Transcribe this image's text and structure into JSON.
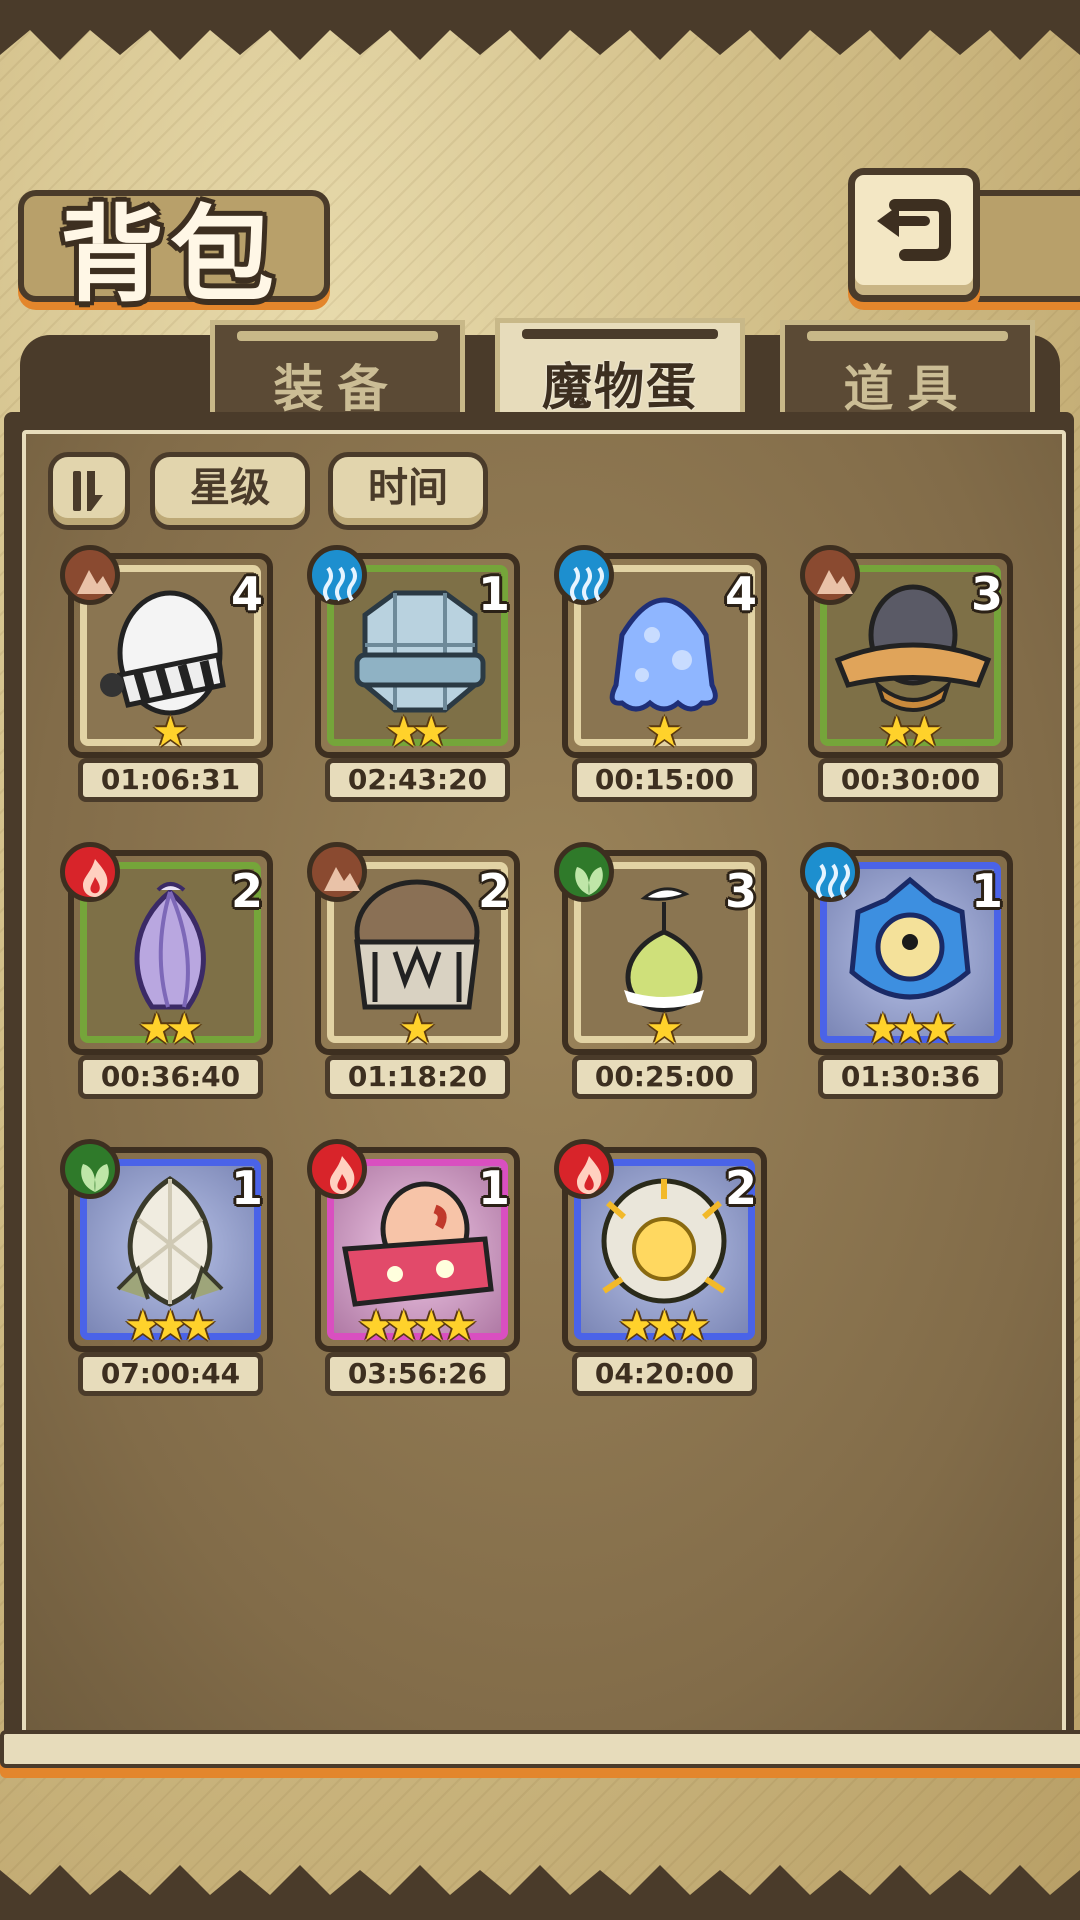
{
  "header": {
    "title": "背包",
    "back_icon": "return-arrow-icon"
  },
  "tabs": [
    {
      "label": "装备",
      "active": false
    },
    {
      "label": "魔物蛋",
      "active": true
    },
    {
      "label": "道具",
      "active": false
    }
  ],
  "filters": {
    "sort_icon": "sort-toggle-icon",
    "star_label": "星级",
    "time_label": "时间"
  },
  "eggs": [
    {
      "element": "earth",
      "count": "4",
      "stars": 1,
      "rarity": "tan",
      "timer": "01:06:31",
      "icon": "white-striped-egg-icon"
    },
    {
      "element": "water",
      "count": "1",
      "stars": 2,
      "rarity": "green",
      "timer": "02:43:20",
      "icon": "robot-helmet-egg-icon"
    },
    {
      "element": "water",
      "count": "4",
      "stars": 1,
      "rarity": "tan",
      "timer": "00:15:00",
      "icon": "slime-egg-icon"
    },
    {
      "element": "earth",
      "count": "3",
      "stars": 2,
      "rarity": "green",
      "timer": "00:30:00",
      "icon": "hat-egg-icon"
    },
    {
      "element": "fire",
      "count": "2",
      "stars": 2,
      "rarity": "green",
      "timer": "00:36:40",
      "icon": "flower-bud-egg-icon"
    },
    {
      "element": "earth",
      "count": "2",
      "stars": 1,
      "rarity": "tan",
      "timer": "01:18:20",
      "icon": "armored-egg-icon"
    },
    {
      "element": "grass",
      "count": "3",
      "stars": 1,
      "rarity": "tan",
      "timer": "00:25:00",
      "icon": "sprout-egg-icon"
    },
    {
      "element": "water",
      "count": "1",
      "stars": 3,
      "rarity": "blue",
      "timer": "01:30:36",
      "icon": "eyeball-egg-icon"
    },
    {
      "element": "grass",
      "count": "1",
      "stars": 3,
      "rarity": "blue",
      "timer": "07:00:44",
      "icon": "crystal-egg-icon"
    },
    {
      "element": "fire",
      "count": "1",
      "stars": 4,
      "rarity": "pink",
      "timer": "03:56:26",
      "icon": "kimono-egg-icon"
    },
    {
      "element": "fire",
      "count": "2",
      "stars": 3,
      "rarity": "blue",
      "timer": "04:20:00",
      "icon": "sun-egg-icon"
    }
  ],
  "colors": {
    "earth": "#8a4a30",
    "water": "#1d8fcf",
    "fire": "#d8242a",
    "grass": "#2f7a2a",
    "accent_orange": "#e3862c",
    "frame_dark": "#4a3b2a"
  }
}
